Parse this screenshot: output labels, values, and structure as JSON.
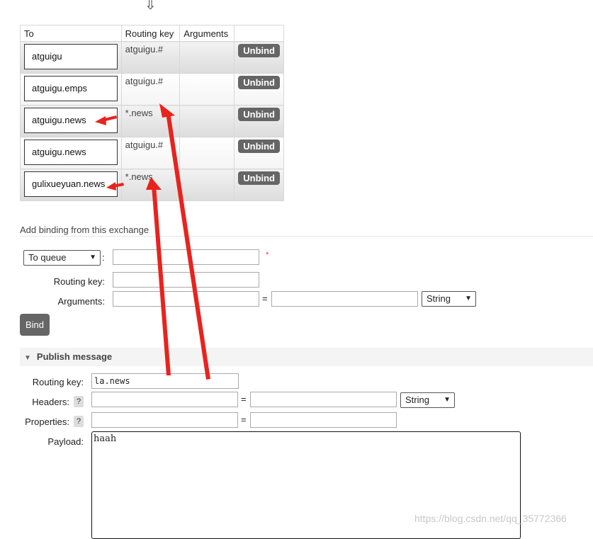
{
  "top_arrow": "⇩",
  "bindings": {
    "headers": [
      "To",
      "Routing key",
      "Arguments",
      ""
    ],
    "rows": [
      {
        "to": "atguigu",
        "routing_key": "atguigu.#",
        "arguments": "",
        "action": "Unbind"
      },
      {
        "to": "atguigu.emps",
        "routing_key": "atguigu.#",
        "arguments": "",
        "action": "Unbind"
      },
      {
        "to": "atguigu.news",
        "routing_key": "*.news",
        "arguments": "",
        "action": "Unbind"
      },
      {
        "to": "atguigu.news",
        "routing_key": "atguigu.#",
        "arguments": "",
        "action": "Unbind"
      },
      {
        "to": "gulixueyuan.news",
        "routing_key": "*.news",
        "arguments": "",
        "action": "Unbind"
      }
    ]
  },
  "add_binding": {
    "title": "Add binding from this exchange",
    "destination_type": "To queue",
    "colon": ":",
    "required_mark": "*",
    "routing_key_label": "Routing key:",
    "arguments_label": "Arguments:",
    "equals": "=",
    "arg_type": "String",
    "bind_label": "Bind"
  },
  "publish": {
    "header": "Publish message",
    "routing_key_label": "Routing key:",
    "routing_key_value": "la.news",
    "headers_label": "Headers:",
    "properties_label": "Properties:",
    "help": "?",
    "equals": "=",
    "header_type": "String",
    "payload_label": "Payload:",
    "payload_value": "haah"
  },
  "watermark": "https://blog.csdn.net/qq_35772366",
  "annotation_color": "#e8231e"
}
